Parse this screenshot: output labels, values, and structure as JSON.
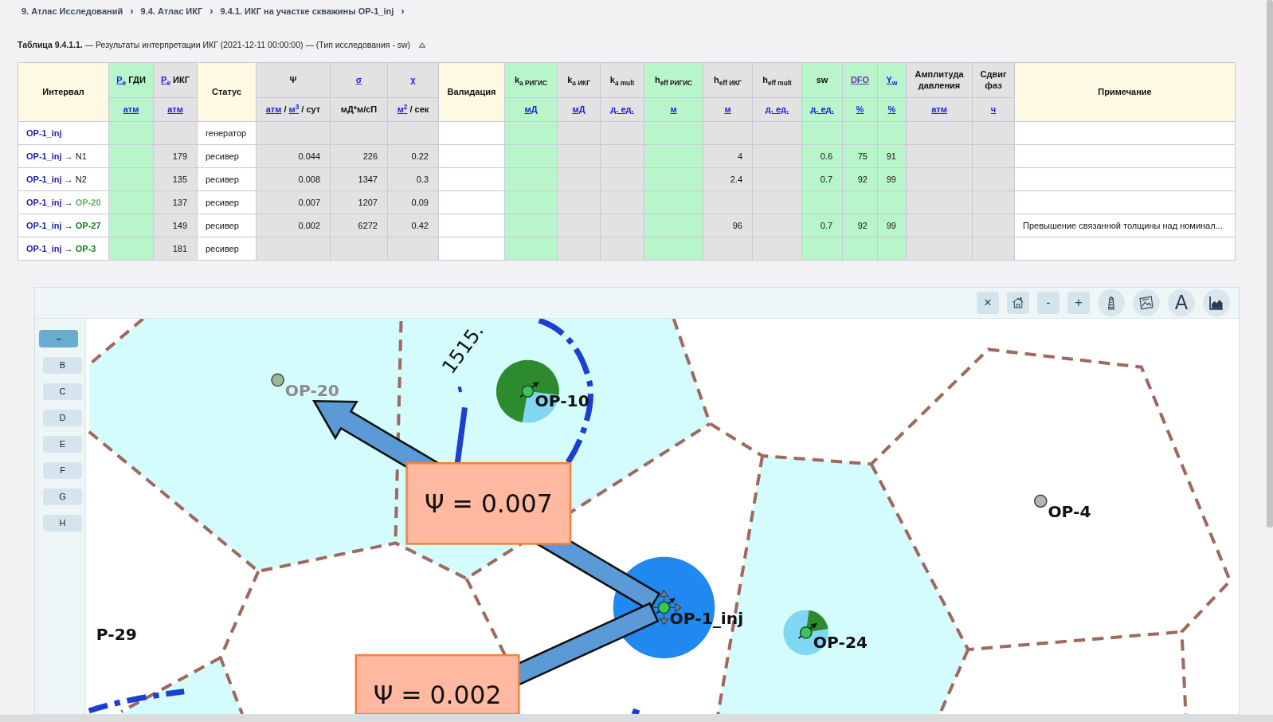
{
  "breadcrumb": [
    {
      "label": "9. Атлас Исследований",
      "separator": "›"
    },
    {
      "label": "9.4. Атлас ИКГ",
      "separator": "›"
    },
    {
      "label": "9.4.1. ИКГ на участке скважины OP-1_inj",
      "separator": "›"
    }
  ],
  "table": {
    "caption": "**Таблица 9.4.1.1.** — Результаты интерпретации ИКГ (2021-12-11 00:00:00) — (Тип исследования - sw)",
    "columns": [
      {
        "title": [
          {
            "text": "Интервал"
          }
        ],
        "kind": "text"
      },
      {
        "title": [
          {
            "text": "P$_{e}$",
            "link": true,
            "visited": false
          },
          {
            "text": " ГДИ"
          }
        ],
        "unit": [
          {
            "text": "атм",
            "link": true,
            "visited": false
          }
        ],
        "kind": "input"
      },
      {
        "title": [
          {
            "text": "P$_{e}$",
            "link": true,
            "visited": false
          },
          {
            "text": " ИКГ"
          }
        ],
        "unit": [
          {
            "text": "атм",
            "link": true,
            "visited": false
          }
        ],
        "kind": "calc"
      },
      {
        "title": [
          {
            "text": "Статус"
          }
        ],
        "kind": "text"
      },
      {
        "title": [
          {
            "text": "Ψ"
          }
        ],
        "unit": [
          {
            "text": "атм",
            "link": true,
            "visited": false
          },
          {
            "text": " / "
          },
          {
            "text": "м$^{3}$",
            "link": true,
            "visited": false
          },
          {
            "text": " / сут"
          }
        ],
        "kind": "calc"
      },
      {
        "title": [
          {
            "text": "σ",
            "link": true,
            "visited": false
          }
        ],
        "unit": [
          {
            "text": "мД*м/сП"
          }
        ],
        "kind": "calc"
      },
      {
        "title": [
          {
            "text": "χ",
            "link": true,
            "visited": false
          }
        ],
        "unit": [
          {
            "text": "м$^{2}$",
            "link": true,
            "visited": false
          },
          {
            "text": " / сек"
          }
        ],
        "kind": "calc"
      },
      {
        "title": [
          {
            "text": "Валидация"
          }
        ],
        "kind": "text"
      },
      {
        "title": [
          {
            "text": "k$_{a РИГИС}$"
          }
        ],
        "unit": [
          {
            "text": "мД",
            "link": true,
            "visited": false
          }
        ],
        "kind": "input"
      },
      {
        "title": [
          {
            "text": "k$_{a ИКГ}$"
          }
        ],
        "unit": [
          {
            "text": "мД",
            "link": true,
            "visited": false
          }
        ],
        "kind": "calc"
      },
      {
        "title": [
          {
            "text": "k$_{a mult}$"
          }
        ],
        "unit": [
          {
            "text": "д. ед.",
            "link": true,
            "visited": false
          }
        ],
        "kind": "calc"
      },
      {
        "title": [
          {
            "text": "h$_{eff РИГИС}$"
          }
        ],
        "unit": [
          {
            "text": "м",
            "link": true,
            "visited": false
          }
        ],
        "kind": "input"
      },
      {
        "title": [
          {
            "text": "h$_{eff ИКГ}$"
          }
        ],
        "unit": [
          {
            "text": "м",
            "link": true,
            "visited": false
          }
        ],
        "kind": "calc"
      },
      {
        "title": [
          {
            "text": "h$_{eff mult}$"
          }
        ],
        "unit": [
          {
            "text": "д. ед.",
            "link": true,
            "visited": false
          }
        ],
        "kind": "calc"
      },
      {
        "title": [
          {
            "text": "sw"
          }
        ],
        "unit": [
          {
            "text": "д. ед.",
            "link": true,
            "visited": false
          }
        ],
        "kind": "input"
      },
      {
        "title": [
          {
            "text": "DFO",
            "link": true,
            "visited": true
          }
        ],
        "unit": [
          {
            "text": "%",
            "link": true,
            "visited": false
          }
        ],
        "kind": "input"
      },
      {
        "title": [
          {
            "text": "Y$_{w}$",
            "link": true,
            "visited": false
          }
        ],
        "unit": [
          {
            "text": "%",
            "link": true,
            "visited": false
          }
        ],
        "kind": "input"
      },
      {
        "title": [
          {
            "text": "Амплитуда давления"
          }
        ],
        "unit": [
          {
            "text": "атм",
            "link": true,
            "visited": false
          }
        ],
        "kind": "calc"
      },
      {
        "title": [
          {
            "text": "Сдвиг фаз"
          }
        ],
        "unit": [
          {
            "text": "ч",
            "link": true,
            "visited": false
          }
        ],
        "kind": "calc"
      },
      {
        "title": [
          {
            "text": "Примечание"
          }
        ],
        "kind": "text"
      }
    ],
    "rows": [
      {
        "cells": [
          {
            "source": "OP-1_inj"
          },
          "",
          "",
          "генератор",
          "",
          "",
          "",
          "",
          "",
          "",
          "",
          "",
          "",
          "",
          "",
          "",
          "",
          "",
          "",
          ""
        ]
      },
      {
        "cells": [
          {
            "source": "OP-1_inj",
            "arrow": "→",
            "target": {
              "text": "N1",
              "kind": "node"
            }
          },
          "",
          "179",
          "ресивер",
          "0.044",
          "226",
          "0.22",
          "",
          "",
          "",
          "",
          "",
          "4",
          "",
          "0.6",
          "75",
          "91",
          "",
          "",
          ""
        ]
      },
      {
        "cells": [
          {
            "source": "OP-1_inj",
            "arrow": "→",
            "target": {
              "text": "N2",
              "kind": "node"
            }
          },
          "",
          "135",
          "ресивер",
          "0.008",
          "1347",
          "0.3",
          "",
          "",
          "",
          "",
          "",
          "2.4",
          "",
          "0.7",
          "92",
          "99",
          "",
          "",
          ""
        ]
      },
      {
        "cells": [
          {
            "source": "OP-1_inj",
            "arrow": "→",
            "target": {
              "text": "OP-20",
              "kind": "well",
              "color": "#5fb35f"
            }
          },
          "",
          "137",
          "ресивер",
          "0.007",
          "1207",
          "0.09",
          "",
          "",
          "",
          "",
          "",
          "",
          "",
          "",
          "",
          "",
          "",
          "",
          ""
        ]
      },
      {
        "cells": [
          {
            "source": "OP-1_inj",
            "arrow": "→",
            "target": {
              "text": "OP-27",
              "kind": "well",
              "color": "#127f12"
            }
          },
          "",
          "149",
          "ресивер",
          "0.002",
          "6272",
          "0.42",
          "",
          "",
          "",
          "",
          "",
          "96",
          "",
          "0.7",
          "92",
          "99",
          "",
          "",
          "Превышение связанной толщины над номинал..."
        ]
      },
      {
        "cells": [
          {
            "source": "OP-1_inj",
            "arrow": "→",
            "target": {
              "text": "OP-3",
              "kind": "well",
              "color": "#127f12"
            }
          },
          "",
          "181",
          "ресивер",
          "",
          "",
          "",
          "",
          "",
          "",
          "",
          "",
          "",
          "",
          "",
          "",
          "",
          "",
          "",
          ""
        ]
      }
    ]
  },
  "map": {
    "toolbar": [
      {
        "kind": "text",
        "label": "×"
      },
      {
        "kind": "icon"
      },
      {
        "kind": "text",
        "label": "-"
      },
      {
        "kind": "text",
        "label": "+"
      },
      {
        "kind": "icon"
      },
      {
        "kind": "icon"
      },
      {
        "kind": "text",
        "label": "A"
      },
      {
        "kind": "icon"
      }
    ],
    "layers": [
      {
        "label": "–",
        "selected": true
      },
      {
        "label": "B",
        "selected": false
      },
      {
        "label": "C",
        "selected": false
      },
      {
        "label": "D",
        "selected": false
      },
      {
        "label": "E",
        "selected": false
      },
      {
        "label": "F",
        "selected": false
      },
      {
        "label": "G",
        "selected": false
      },
      {
        "label": "H",
        "selected": false
      }
    ],
    "contour_labels": [
      "1515."
    ],
    "wells": [
      {
        "name": "OP-20",
        "kind": "dot",
        "color": "#9cb89c",
        "muted": true
      },
      {
        "name": "OP-10",
        "kind": "pie",
        "muted": false
      },
      {
        "name": "OP-4",
        "kind": "dot",
        "color": "#b4b4b4",
        "muted": false
      },
      {
        "name": "OP-1_inj",
        "kind": "injector",
        "muted": false
      },
      {
        "name": "P-29",
        "kind": "label",
        "muted": false
      },
      {
        "name": "OP-24",
        "kind": "pie",
        "muted": false
      }
    ],
    "flows": [
      {
        "label": "Ψ = 0.007"
      },
      {
        "label": "Ψ = 0.002"
      }
    ]
  }
}
